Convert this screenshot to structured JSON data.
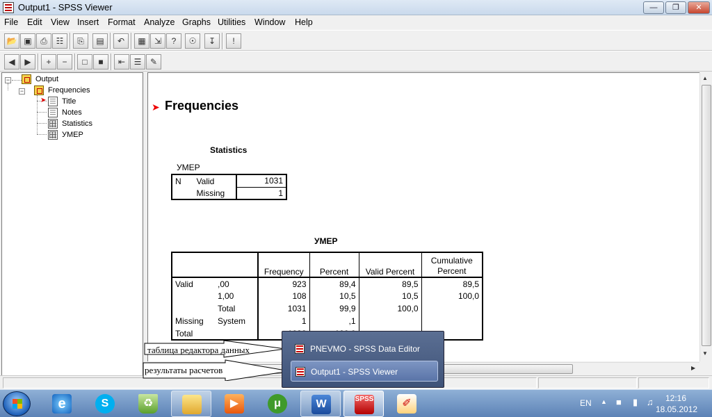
{
  "window": {
    "title": "Output1 - SPSS Viewer",
    "min_glyph": "—",
    "max_glyph": "❐",
    "close_glyph": "✕"
  },
  "menu": [
    "File",
    "Edit",
    "View",
    "Insert",
    "Format",
    "Analyze",
    "Graphs",
    "Utilities",
    "Window",
    "Help"
  ],
  "outline": {
    "root": "Output",
    "group": "Frequencies",
    "items": [
      "Title",
      "Notes",
      "Statistics",
      "УМЕР"
    ]
  },
  "output": {
    "heading": "Frequencies",
    "statistics": {
      "title": "Statistics",
      "variable": "УМЕР",
      "row_label": "N",
      "rows": [
        {
          "label": "Valid",
          "value": "1031"
        },
        {
          "label": "Missing",
          "value": "1"
        }
      ]
    },
    "freq": {
      "title": "УМЕР",
      "headers": [
        "Frequency",
        "Percent",
        "Valid Percent",
        "Cumulative Percent"
      ],
      "header_cumulative_line1": "Cumulative",
      "header_cumulative_line2": "Percent",
      "rows": [
        {
          "group": "Valid",
          "label": ",00",
          "frequency": "923",
          "percent": "89,4",
          "valid_percent": "89,5",
          "cumulative": "89,5"
        },
        {
          "group": "",
          "label": "1,00",
          "frequency": "108",
          "percent": "10,5",
          "valid_percent": "10,5",
          "cumulative": "100,0"
        },
        {
          "group": "",
          "label": "Total",
          "frequency": "1031",
          "percent": "99,9",
          "valid_percent": "100,0",
          "cumulative": ""
        },
        {
          "group": "Missing",
          "label": "System",
          "frequency": "1",
          "percent": ",1",
          "valid_percent": "",
          "cumulative": ""
        },
        {
          "group": "Total",
          "label": "",
          "frequency": "1032",
          "percent": "100,0",
          "valid_percent": "",
          "cumulative": ""
        }
      ]
    }
  },
  "callouts": {
    "data_editor": "таблица редактора данных",
    "results": "результаты расчетов"
  },
  "taskbar_popup": {
    "items": [
      {
        "label": "PNEVMO - SPSS Data Editor",
        "active": false
      },
      {
        "label": "Output1 - SPSS Viewer",
        "active": true
      }
    ]
  },
  "taskbar": {
    "language": "EN",
    "time": "12:16",
    "date": "18.05.2012",
    "spss_label": "SPSS",
    "apps": [
      "internet-explorer",
      "skype",
      "recycle",
      "explorer",
      "media-player",
      "utorrent",
      "word",
      "spss",
      "paint"
    ]
  },
  "colors": {
    "accent_red": "#e00000",
    "taskbar": "#5c82b6",
    "popup": "#3e5278"
  }
}
